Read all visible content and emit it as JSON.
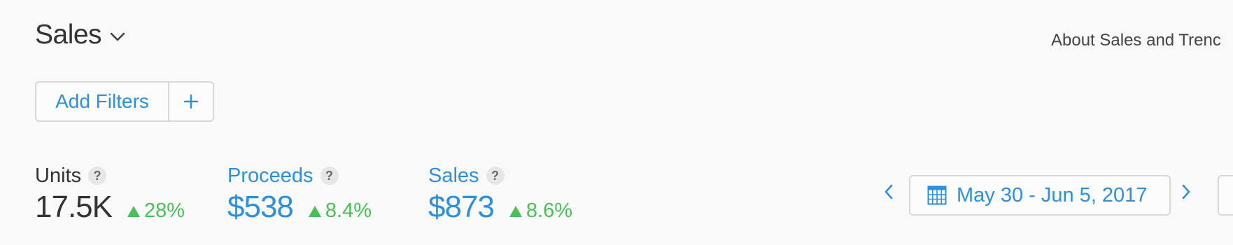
{
  "header": {
    "title": "Sales",
    "title_icon": "chevron-down-icon",
    "about_link": "About Sales and Trenc"
  },
  "filters": {
    "label": "Add Filters",
    "add_icon": "plus-icon"
  },
  "metrics": [
    {
      "label": "Units",
      "help": "?",
      "value": "17.5K",
      "change": "28%",
      "trend": "up"
    },
    {
      "label": "Proceeds",
      "help": "?",
      "value": "$538",
      "change": "8.4%",
      "trend": "up"
    },
    {
      "label": "Sales",
      "help": "?",
      "value": "$873",
      "change": "8.6%",
      "trend": "up"
    }
  ],
  "date_range": {
    "label": "May 30 - Jun 5, 2017",
    "prev_icon": "chevron-left-icon",
    "next_icon": "chevron-right-icon",
    "calendar_icon": "calendar-icon"
  },
  "colors": {
    "accent": "#2f8fdc",
    "positive": "#4dbd5a",
    "text": "#333333",
    "border": "#d8d8d8",
    "background": "#f9f9f9"
  }
}
